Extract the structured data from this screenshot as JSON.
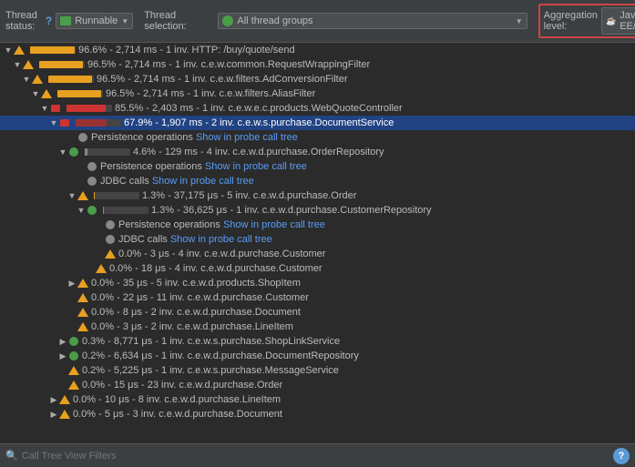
{
  "header": {
    "thread_status_label": "Thread status:",
    "thread_status_help": "?",
    "thread_selection_label": "Thread selection:",
    "runnable_label": "Runnable",
    "all_thread_groups": "All thread groups",
    "aggregation_label": "Aggregation level:",
    "aggregation_value": "Java EE/Spring"
  },
  "tree": {
    "rows": [
      {
        "id": 0,
        "indent": 0,
        "expand": "▼",
        "icon": "orange-triangle",
        "bar_pct": 97,
        "bar_color": "orange",
        "text": "96.6% - 2,714 ms - 1 inv. HTTP: /buy/quote/send",
        "link": null,
        "selected": false
      },
      {
        "id": 1,
        "indent": 1,
        "expand": "▼",
        "icon": "orange-triangle",
        "bar_pct": 96,
        "bar_color": "orange",
        "text": "96.5% - 2,714 ms - 1 inv. c.e.w.common.RequestWrappingFilter",
        "link": null,
        "selected": false
      },
      {
        "id": 2,
        "indent": 2,
        "expand": "▼",
        "icon": "orange-triangle",
        "bar_pct": 96,
        "bar_color": "orange",
        "text": "96.5% - 2,714 ms - 1 inv. c.e.w.filters.AdConversionFilter",
        "link": null,
        "selected": false
      },
      {
        "id": 3,
        "indent": 3,
        "expand": "▼",
        "icon": "orange-triangle",
        "bar_pct": 96,
        "bar_color": "orange",
        "text": "96.5% - 2,714 ms - 1 inv. c.e.w.filters.AliasFilter",
        "link": null,
        "selected": false
      },
      {
        "id": 4,
        "indent": 4,
        "expand": "▼",
        "icon": "red-rect",
        "bar_pct": 85,
        "bar_color": "red",
        "text": "85.5% - 2,403 ms - 1 inv. c.e.w.e.c.products.WebQuoteController",
        "link": null,
        "selected": false
      },
      {
        "id": 5,
        "indent": 5,
        "expand": "▼",
        "icon": "red-rect",
        "bar_pct": 68,
        "bar_color": "dark-red",
        "text": "67.9% - 1,907 ms - 2 inv. c.e.w.s.purchase.DocumentService",
        "link": null,
        "selected": true
      },
      {
        "id": 6,
        "indent": 6,
        "expand": null,
        "icon": "gray-circle",
        "bar_pct": 0,
        "bar_color": "gray",
        "text": "Persistence operations ",
        "link": "Show in probe call tree",
        "link_href": "#",
        "selected": false
      },
      {
        "id": 7,
        "indent": 6,
        "expand": "▼",
        "icon": "green-circle",
        "bar_pct": 5,
        "bar_color": "gray",
        "text": "4.6% - 129 ms - 4 inv. c.e.w.d.purchase.OrderRepository",
        "link": null,
        "selected": false
      },
      {
        "id": 8,
        "indent": 7,
        "expand": null,
        "icon": "gray-circle",
        "bar_pct": 0,
        "bar_color": "gray",
        "text": "Persistence operations ",
        "link": "Show in probe call tree",
        "link_href": "#",
        "selected": false
      },
      {
        "id": 9,
        "indent": 7,
        "expand": null,
        "icon": "gray-circle",
        "bar_pct": 0,
        "bar_color": "gray",
        "text": "JDBC calls ",
        "link": "Show in probe call tree",
        "link_href": "#",
        "selected": false
      },
      {
        "id": 10,
        "indent": 7,
        "expand": "▼",
        "icon": "orange-triangle",
        "bar_pct": 2,
        "bar_color": "orange",
        "text": "1.3% - 37,175 μs - 5 inv. c.e.w.d.purchase.Order",
        "link": null,
        "selected": false
      },
      {
        "id": 11,
        "indent": 8,
        "expand": "▼",
        "icon": "green-circle",
        "bar_pct": 2,
        "bar_color": "gray",
        "text": "1.3% - 36,625 μs - 1 inv. c.e.w.d.purchase.CustomerRepository",
        "link": null,
        "selected": false
      },
      {
        "id": 12,
        "indent": 9,
        "expand": null,
        "icon": "gray-circle",
        "bar_pct": 0,
        "bar_color": "gray",
        "text": "Persistence operations ",
        "link": "Show in probe call tree",
        "link_href": "#",
        "selected": false
      },
      {
        "id": 13,
        "indent": 9,
        "expand": null,
        "icon": "gray-circle",
        "bar_pct": 0,
        "bar_color": "gray",
        "text": "JDBC calls ",
        "link": "Show in probe call tree",
        "link_href": "#",
        "selected": false
      },
      {
        "id": 14,
        "indent": 9,
        "expand": null,
        "icon": "orange-triangle",
        "bar_pct": 0,
        "bar_color": "orange",
        "text": "0.0% - 3 μs - 4 inv. c.e.w.d.purchase.Customer",
        "link": null,
        "selected": false
      },
      {
        "id": 15,
        "indent": 8,
        "expand": null,
        "icon": "orange-triangle",
        "bar_pct": 0,
        "bar_color": "orange",
        "text": "0.0% - 18 μs - 4 inv. c.e.w.d.purchase.Customer",
        "link": null,
        "selected": false
      },
      {
        "id": 16,
        "indent": 6,
        "expand": "▶",
        "icon": "orange-triangle",
        "bar_pct": 0,
        "bar_color": "orange",
        "text": "0.0% - 35 μs - 5 inv. c.e.w.d.products.ShopItem",
        "link": null,
        "selected": false
      },
      {
        "id": 17,
        "indent": 6,
        "expand": null,
        "icon": "orange-triangle",
        "bar_pct": 0,
        "bar_color": "orange",
        "text": "0.0% - 22 μs - 11 inv. c.e.w.d.purchase.Customer",
        "link": null,
        "selected": false
      },
      {
        "id": 18,
        "indent": 6,
        "expand": null,
        "icon": "orange-triangle",
        "bar_pct": 0,
        "bar_color": "orange",
        "text": "0.0% - 8 μs - 2 inv. c.e.w.d.purchase.Document",
        "link": null,
        "selected": false
      },
      {
        "id": 19,
        "indent": 6,
        "expand": null,
        "icon": "orange-triangle",
        "bar_pct": 0,
        "bar_color": "orange",
        "text": "0.0% - 3 μs - 2 inv. c.e.w.d.purchase.LineItem",
        "link": null,
        "selected": false
      },
      {
        "id": 20,
        "indent": 5,
        "expand": "▶",
        "icon": "green-circle",
        "bar_pct": 0,
        "bar_color": "gray",
        "text": "0.3% - 8,771 μs - 1 inv. c.e.w.s.purchase.ShopLinkService",
        "link": null,
        "selected": false
      },
      {
        "id": 21,
        "indent": 5,
        "expand": "▶",
        "icon": "green-circle",
        "bar_pct": 0,
        "bar_color": "gray",
        "text": "0.2% - 6,634 μs - 1 inv. c.e.w.d.purchase.DocumentRepository",
        "link": null,
        "selected": false
      },
      {
        "id": 22,
        "indent": 5,
        "expand": null,
        "icon": "orange-triangle",
        "bar_pct": 0,
        "bar_color": "orange",
        "text": "0.2% - 5,225 μs - 1 inv. c.e.w.s.purchase.MessageService",
        "link": null,
        "selected": false
      },
      {
        "id": 23,
        "indent": 5,
        "expand": null,
        "icon": "orange-triangle",
        "bar_pct": 0,
        "bar_color": "orange",
        "text": "0.0% - 15 μs - 23 inv. c.e.w.d.purchase.Order",
        "link": null,
        "selected": false
      },
      {
        "id": 24,
        "indent": 5,
        "expand": "▶",
        "icon": "orange-triangle",
        "bar_pct": 0,
        "bar_color": "orange",
        "text": "0.0% - 10 μs - 8 inv. c.e.w.d.purchase.LineItem",
        "link": null,
        "selected": false
      },
      {
        "id": 25,
        "indent": 5,
        "expand": "▶",
        "icon": "orange-triangle",
        "bar_pct": 0,
        "bar_color": "orange",
        "text": "0.0% - 5 μs - 3 inv. c.e.w.d.purchase.Document",
        "link": null,
        "selected": false
      }
    ]
  },
  "bottom_bar": {
    "search_placeholder": "Call Tree View Filters",
    "help_label": "?"
  }
}
